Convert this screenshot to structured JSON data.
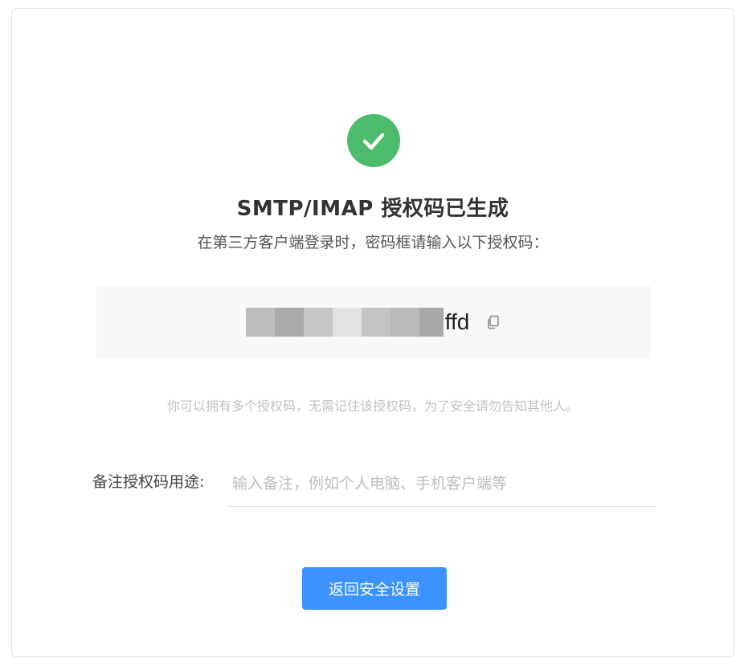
{
  "result": {
    "title": "SMTP/IMAP 授权码已生成",
    "subtitle": "在第三方客户端登录时，密码框请输入以下授权码：",
    "status_icon": "check-circle-icon",
    "status_color": "#4cbb6c"
  },
  "auth_code": {
    "visible_suffix": "ffd",
    "masked": true,
    "copy_icon": "copy-icon"
  },
  "hint": "你可以拥有多个授权码，无需记住该授权码，为了安全请勿告知其他人。",
  "remark": {
    "label": "备注授权码用途:",
    "placeholder": "输入备注，例如个人电脑、手机客户端等",
    "value": ""
  },
  "actions": {
    "back_label": "返回安全设置",
    "accent_color": "#3d93fd"
  }
}
